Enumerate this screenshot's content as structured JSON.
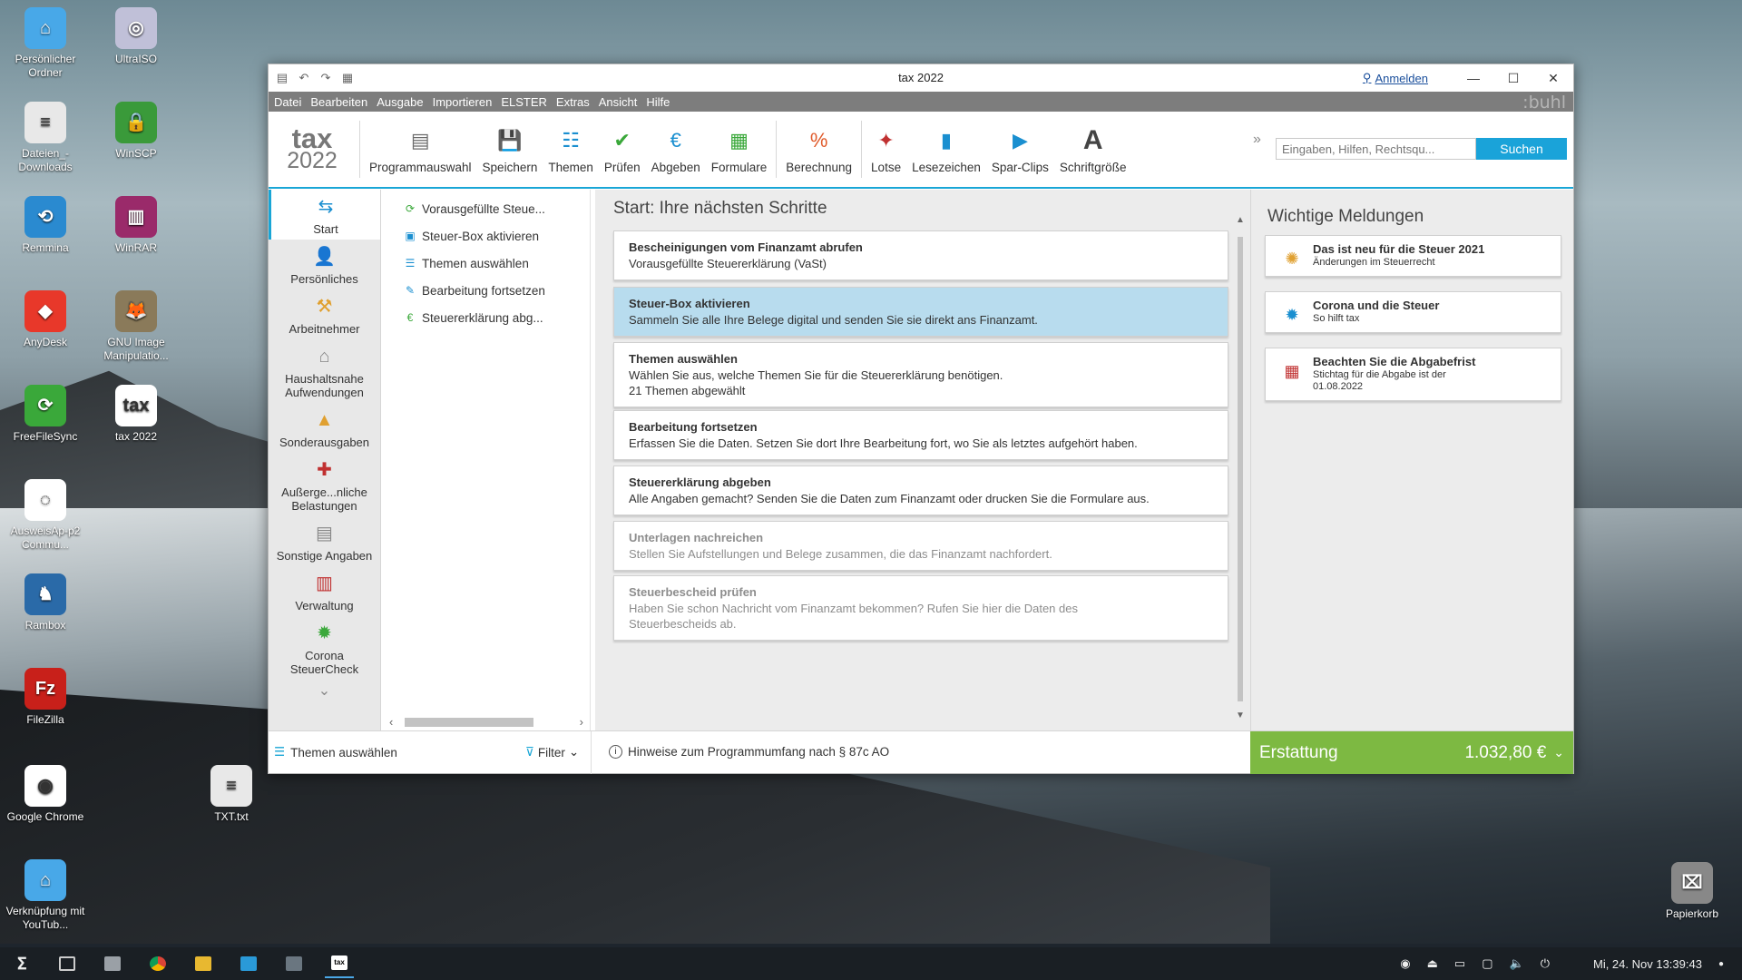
{
  "desktop": {
    "icons": [
      {
        "label": "Persönlicher Ordner",
        "icon": "folder-home-icon",
        "color": "#48a8e8"
      },
      {
        "label": "UltraISO",
        "icon": "disc-icon",
        "color": "#c0c0d8"
      },
      {
        "label": "Dateien_-Downloads",
        "icon": "document-icon",
        "color": "#e8e8e8"
      },
      {
        "label": "WinSCP",
        "icon": "lock-computer-icon",
        "color": "#3a9a3a"
      },
      {
        "label": "Remmina",
        "icon": "remmina-icon",
        "color": "#2a8ad0"
      },
      {
        "label": "WinRAR",
        "icon": "archive-books-icon",
        "color": "#9a2a6a"
      },
      {
        "label": "AnyDesk",
        "icon": "anydesk-icon",
        "color": "#e8382a"
      },
      {
        "label": "GNU Image Manipulatio...",
        "icon": "gimp-icon",
        "color": "#8a7a5a"
      },
      {
        "label": "FreeFileSync",
        "icon": "sync-icon",
        "color": "#3aa83a"
      },
      {
        "label": "tax 2022",
        "icon": "tax-app-icon",
        "color": "#ffffff"
      },
      {
        "label": "AusweisAp-p2 Commu...",
        "icon": "ausweis-icon",
        "color": "#ffffff"
      },
      {
        "label": "Rambox",
        "icon": "rambox-icon",
        "color": "#2a6aa8"
      },
      {
        "label": "FileZilla",
        "icon": "filezilla-icon",
        "color": "#c8201a"
      },
      {
        "label": "Google Chrome",
        "icon": "chrome-icon",
        "color": "#ffffff"
      },
      {
        "label": "TXT.txt",
        "icon": "text-file-icon",
        "color": "#e8e8e8"
      },
      {
        "label": "Verknüpfung mit YouTub...",
        "icon": "folder-link-icon",
        "color": "#48a8e8"
      },
      {
        "label": "Papierkorb",
        "icon": "trash-icon",
        "color": "#888888"
      }
    ]
  },
  "window": {
    "title": "tax 2022",
    "login": "Anmelden",
    "controls": {
      "minimize": "—",
      "maximize": "☐",
      "close": "✕"
    }
  },
  "menu": {
    "items": [
      "Datei",
      "Bearbeiten",
      "Ausgabe",
      "Importieren",
      "ELSTER",
      "Extras",
      "Ansicht",
      "Hilfe"
    ],
    "brand": ":buhl"
  },
  "toolbar": {
    "logo_top": "tax",
    "logo_bottom": "2022",
    "tools": [
      {
        "label": "Programmauswahl",
        "icon": "program-select-icon"
      },
      {
        "label": "Speichern",
        "icon": "save-icon"
      },
      {
        "label": "Themen",
        "icon": "topics-icon"
      },
      {
        "label": "Prüfen",
        "icon": "check-icon"
      },
      {
        "label": "Abgeben",
        "icon": "submit-icon"
      },
      {
        "label": "Formulare",
        "icon": "forms-icon"
      },
      {
        "label": "Berechnung",
        "icon": "calculation-icon"
      },
      {
        "label": "Lotse",
        "icon": "compass-icon"
      },
      {
        "label": "Lesezeichen",
        "icon": "bookmark-icon"
      },
      {
        "label": "Spar-Clips",
        "icon": "video-icon"
      },
      {
        "label": "Schriftgröße",
        "icon": "font-size-icon"
      }
    ],
    "overflow": "»",
    "search_placeholder": "Eingaben, Hilfen, Rechtsqu...",
    "search_button": "Suchen"
  },
  "nav": {
    "items": [
      {
        "label": "Start",
        "icon": "signpost-icon"
      },
      {
        "label": "Persönliches",
        "icon": "person-icon"
      },
      {
        "label": "Arbeitnehmer",
        "icon": "worker-icon"
      },
      {
        "label": "Haushaltsnahe Aufwendungen",
        "icon": "household-icon"
      },
      {
        "label": "Sonderausgaben",
        "icon": "special-expenses-icon"
      },
      {
        "label": "Außerge...nliche Belastungen",
        "icon": "first-aid-icon"
      },
      {
        "label": "Sonstige Angaben",
        "icon": "documents-icon"
      },
      {
        "label": "Verwaltung",
        "icon": "binders-icon"
      },
      {
        "label": "Corona SteuerCheck",
        "icon": "corona-icon"
      }
    ],
    "more": "⌄"
  },
  "tree": {
    "items": [
      {
        "label": "Vorausgefüllte Steue...",
        "icon": "prefilled-icon"
      },
      {
        "label": "Steuer-Box aktivieren",
        "icon": "tax-box-icon"
      },
      {
        "label": "Themen auswählen",
        "icon": "list-icon"
      },
      {
        "label": "Bearbeitung fortsetzen",
        "icon": "pencil-icon"
      },
      {
        "label": "Steuererklärung abg...",
        "icon": "submit-small-icon"
      }
    ]
  },
  "main": {
    "title": "Start: Ihre nächsten Schritte",
    "cards": [
      {
        "title": "Bescheinigungen vom Finanzamt abrufen",
        "lines": [
          "Vorausgefüllte Steuererklärung (VaSt)"
        ],
        "state": "normal"
      },
      {
        "title": "Steuer-Box aktivieren",
        "lines": [
          "Sammeln Sie alle Ihre Belege digital und senden Sie sie direkt ans Finanzamt."
        ],
        "state": "highlight"
      },
      {
        "title": "Themen auswählen",
        "lines": [
          "Wählen Sie aus, welche Themen Sie für die Steuererklärung benötigen.",
          "21 Themen abgewählt"
        ],
        "state": "normal"
      },
      {
        "title": "Bearbeitung fortsetzen",
        "lines": [
          "Erfassen Sie die Daten. Setzen Sie dort Ihre Bearbeitung fort, wo Sie als letztes aufgehört haben."
        ],
        "state": "normal"
      },
      {
        "title": "Steuererklärung abgeben",
        "lines": [
          "Alle Angaben gemacht? Senden Sie die Daten zum Finanzamt oder drucken Sie die Formulare aus."
        ],
        "state": "normal"
      },
      {
        "title": "Unterlagen nachreichen",
        "lines": [
          "Stellen Sie Aufstellungen und Belege zusammen, die das Finanzamt nachfordert."
        ],
        "state": "dim"
      },
      {
        "title": "Steuerbescheid prüfen",
        "lines": [
          "Haben Sie schon Nachricht vom Finanzamt bekommen? Rufen Sie hier die Daten des",
          "Steuerbescheids ab."
        ],
        "state": "dim"
      }
    ]
  },
  "side": {
    "title": "Wichtige Meldungen",
    "cards": [
      {
        "title": "Das ist neu für die Steuer 2021",
        "lines": [
          "Änderungen im Steuerrecht"
        ],
        "icon": "new-badge-icon"
      },
      {
        "title": "Corona und die Steuer",
        "lines": [
          "So hilft tax"
        ],
        "icon": "corona-icon"
      },
      {
        "title": "Beachten Sie die Abgabefrist",
        "lines": [
          "Stichtag für die Abgabe ist der",
          "01.08.2022"
        ],
        "icon": "calendar-icon"
      }
    ]
  },
  "status": {
    "topics": "Themen auswählen",
    "filter": "Filter",
    "hint": "Hinweise zum Programmumfang nach § 87c AO",
    "refund_label": "Erstattung",
    "refund_amount": "1.032,80 €"
  },
  "taskbar": {
    "datetime": "Mi, 24. Nov  13:39:43"
  }
}
